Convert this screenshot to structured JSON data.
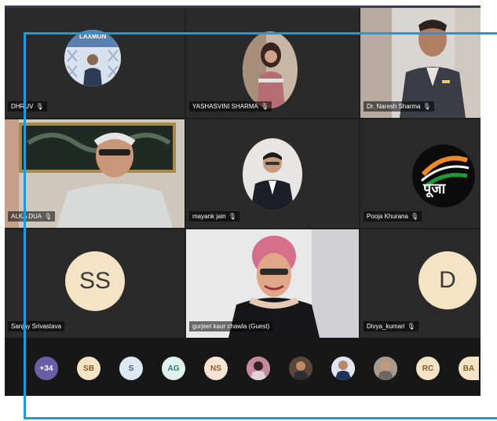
{
  "participants": [
    {
      "name": "DHRUV",
      "banner": "LAXMUN"
    },
    {
      "name": "YASHASVINI SHARMA"
    },
    {
      "name": "Dr. Naresh Sharma"
    },
    {
      "name": "ALKA DUA"
    },
    {
      "name": "mayank jain"
    },
    {
      "name": "Pooja Khurana",
      "logo_text": "पूजा"
    },
    {
      "name": "Sanjay Srivastava",
      "initials": "SS"
    },
    {
      "name": "gurjeet kaur chawla (Guest)"
    },
    {
      "name": "Divya_kumari",
      "initials": "D"
    }
  ],
  "bottom_bar": {
    "more_count": "+34",
    "avatars": [
      "SB",
      "S",
      "AG",
      "NS",
      "RC",
      "BA"
    ]
  },
  "colors": {
    "accent_frame": "#1f9ad6",
    "more_badge": "#6b5ea8",
    "initials_bg": "#f4e3c4"
  },
  "icons": {
    "mic": "mic-muted-icon"
  }
}
